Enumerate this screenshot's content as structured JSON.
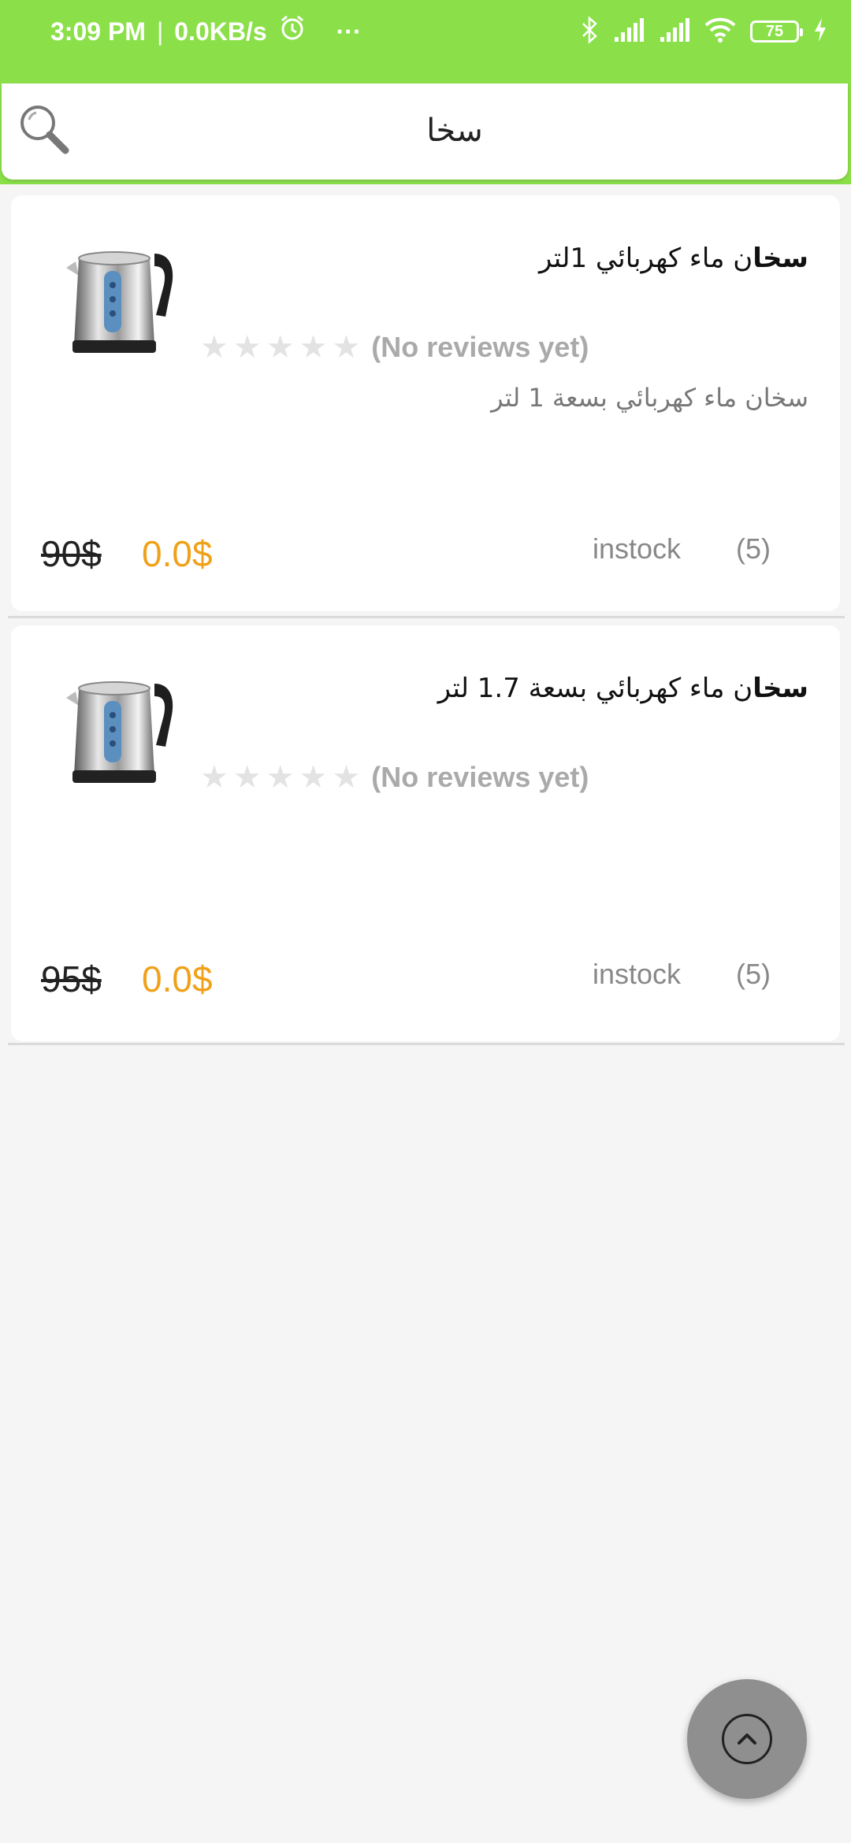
{
  "status_bar": {
    "time": "3:09 PM",
    "separator": "|",
    "network_speed": "0.0KB/s",
    "more": "···",
    "battery_level": "75",
    "icons": [
      "alarm-icon",
      "bluetooth-icon",
      "signal-icon",
      "signal-icon",
      "wifi-icon",
      "battery-icon",
      "charging-icon"
    ]
  },
  "search": {
    "value": "سخا",
    "icon": "search-icon"
  },
  "products": [
    {
      "title_highlight": "سخا",
      "title_rest": "ن ماء كهربائي 1لتر",
      "reviews_text": "(No reviews yet)",
      "rating": 0,
      "description": "سخان ماء كهربائي بسعة 1 لتر",
      "old_price": "90$",
      "new_price": "0.0$",
      "stock_status": "instock",
      "stock_count": "(5)"
    },
    {
      "title_highlight": "سخا",
      "title_rest": "ن ماء كهربائي بسعة 1.7 لتر",
      "reviews_text": "(No reviews yet)",
      "rating": 0,
      "description": "",
      "old_price": "95$",
      "new_price": "0.0$",
      "stock_status": "instock",
      "stock_count": "(5)"
    }
  ],
  "scroll_top_button": {
    "icon": "chevron-up-icon"
  },
  "colors": {
    "accent": "#8be04a",
    "price": "#f0a11a"
  }
}
